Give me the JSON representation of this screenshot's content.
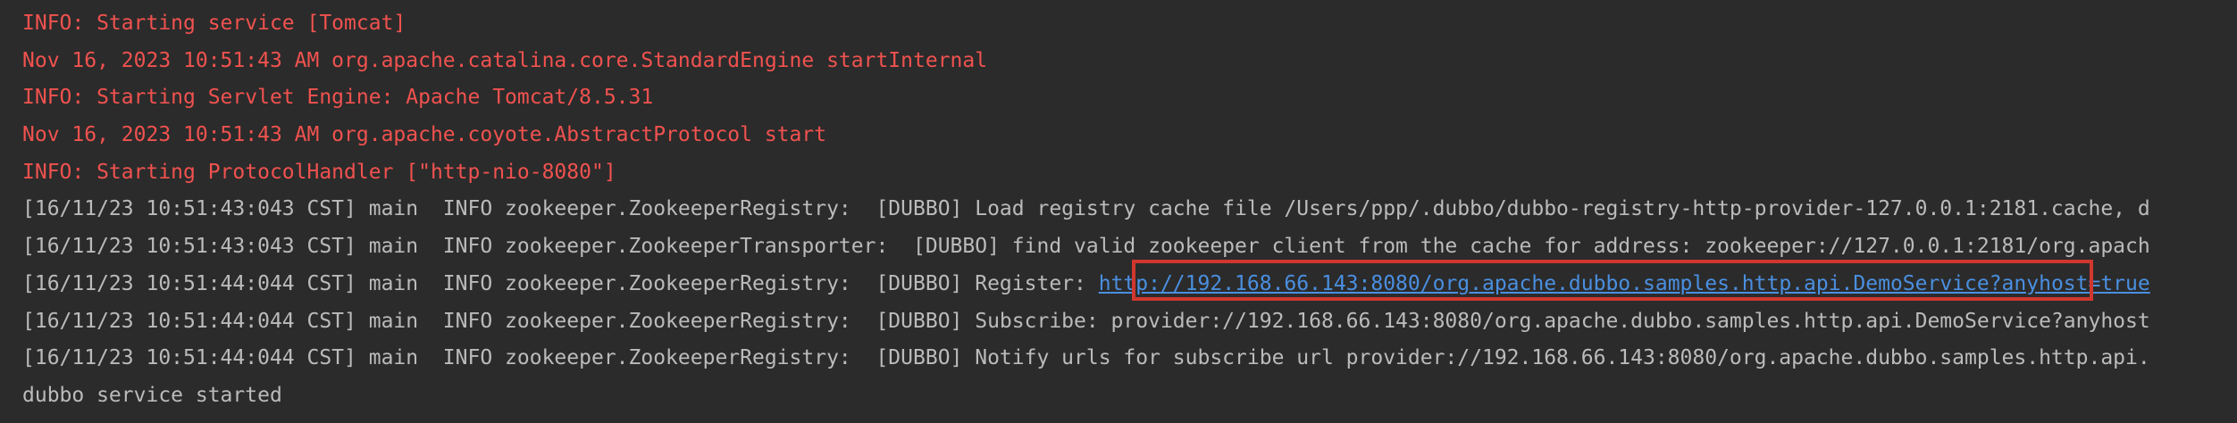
{
  "console": {
    "lines": [
      {
        "kind": "err",
        "text": "INFO: Starting service [Tomcat]"
      },
      {
        "kind": "err",
        "text": "Nov 16, 2023 10:51:43 AM org.apache.catalina.core.StandardEngine startInternal"
      },
      {
        "kind": "err",
        "text": "INFO: Starting Servlet Engine: Apache Tomcat/8.5.31"
      },
      {
        "kind": "err",
        "text": "Nov 16, 2023 10:51:43 AM org.apache.coyote.AbstractProtocol start"
      },
      {
        "kind": "err",
        "text": "INFO: Starting ProtocolHandler [\"http-nio-8080\"]"
      },
      {
        "kind": "out",
        "text": "[16/11/23 10:51:43:043 CST] main  INFO zookeeper.ZookeeperRegistry:  [DUBBO] Load registry cache file /Users/ppp/.dubbo/dubbo-registry-http-provider-127.0.0.1:2181.cache, d"
      },
      {
        "kind": "out",
        "text": "[16/11/23 10:51:43:043 CST] main  INFO zookeeper.ZookeeperTransporter:  [DUBBO] find valid zookeeper client from the cache for address: zookeeper://127.0.0.1:2181/org.apach"
      },
      {
        "kind": "out-link",
        "prefix": "[16/11/23 10:51:44:044 CST] main  INFO zookeeper.ZookeeperRegistry:  [DUBBO] Register: ",
        "link": "http://192.168.66.143:8080/org.apache.dubbo.samples.http.api.DemoService?anyhost=true"
      },
      {
        "kind": "out",
        "text": "[16/11/23 10:51:44:044 CST] main  INFO zookeeper.ZookeeperRegistry:  [DUBBO] Subscribe: provider://192.168.66.143:8080/org.apache.dubbo.samples.http.api.DemoService?anyhost"
      },
      {
        "kind": "out",
        "text": "[16/11/23 10:51:44:044 CST] main  INFO zookeeper.ZookeeperRegistry:  [DUBBO] Notify urls for subscribe url provider://192.168.66.143:8080/org.apache.dubbo.samples.http.api."
      },
      {
        "kind": "out",
        "text": "dubbo service started"
      }
    ]
  },
  "colors": {
    "background": "#2b2b2b",
    "stderr_text": "#f0524f",
    "stdout_text": "#bbbbbb",
    "link": "#4a8fe0",
    "highlight_box": "#d0372f"
  }
}
